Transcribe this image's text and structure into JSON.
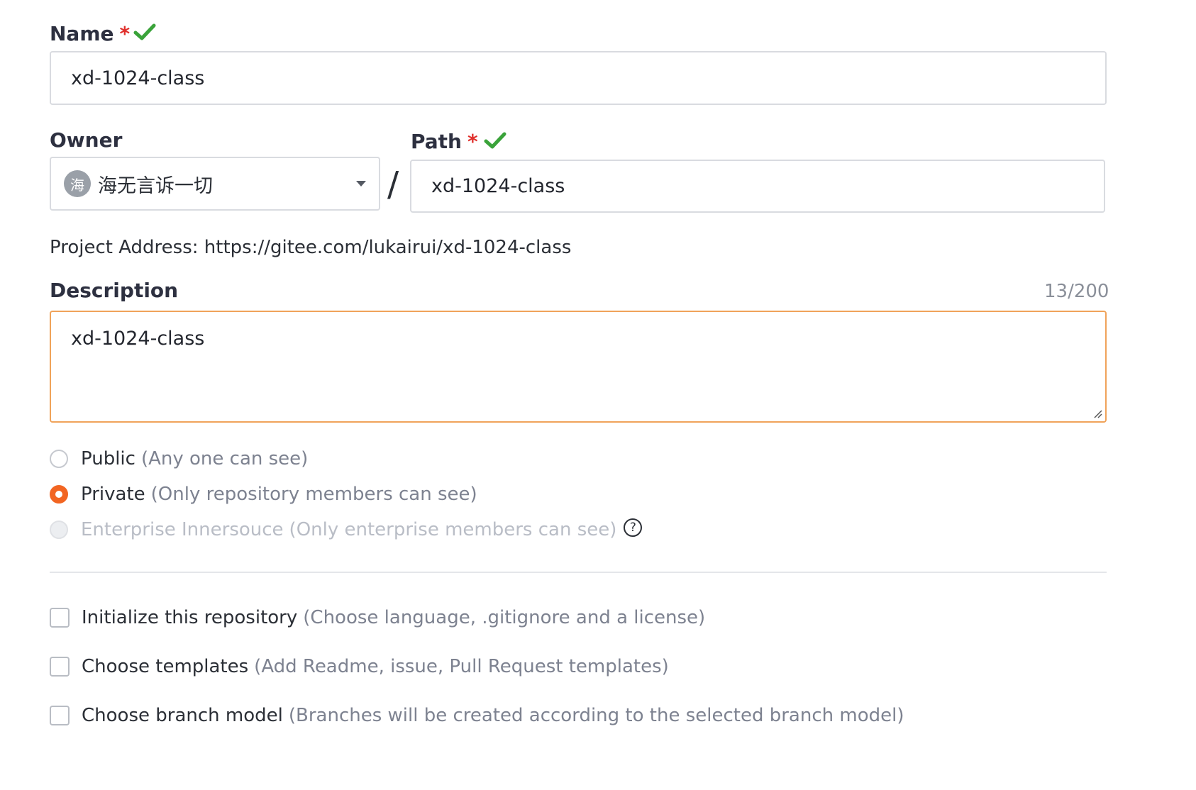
{
  "form": {
    "name": {
      "label": "Name",
      "required_mark": "*",
      "value": "xd-1024-class"
    },
    "owner": {
      "label": "Owner",
      "avatar_text": "海",
      "selected": "海无言诉一切"
    },
    "separator": "/",
    "path": {
      "label": "Path",
      "required_mark": "*",
      "value": "xd-1024-class"
    },
    "project_address": "Project Address: https://gitee.com/lukairui/xd-1024-class",
    "description": {
      "label": "Description",
      "counter": "13/200",
      "value": "xd-1024-class"
    },
    "visibility": [
      {
        "label": "Public",
        "hint": "(Any one can see)",
        "state": "unchecked"
      },
      {
        "label": "Private",
        "hint": "(Only repository members can see)",
        "state": "checked"
      },
      {
        "label": "Enterprise Innersouce",
        "hint": "(Only enterprise members can see)",
        "state": "disabled"
      }
    ],
    "help_icon_text": "?",
    "options": [
      {
        "label": "Initialize this repository",
        "hint": "(Choose language, .gitignore and a license)"
      },
      {
        "label": "Choose templates",
        "hint": "(Add Readme, issue, Pull Request templates)"
      },
      {
        "label": "Choose branch model",
        "hint": "(Branches will be created according to the selected branch model)"
      }
    ]
  },
  "colors": {
    "accent": "#f26522",
    "success": "#3aa33a",
    "required": "#e0302c",
    "focus_border": "#f0a35a"
  },
  "icons": {
    "valid": "check-icon",
    "help": "question-circle-icon",
    "dropdown": "caret-down-icon"
  }
}
